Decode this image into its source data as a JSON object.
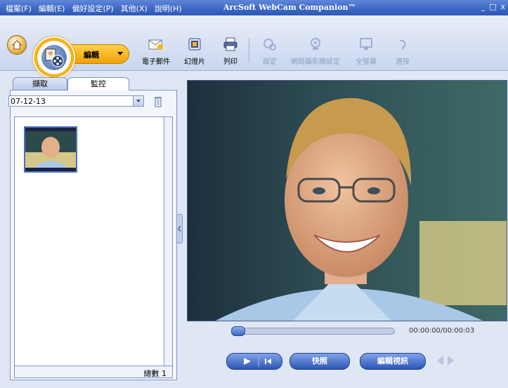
{
  "app": {
    "title": "ArcSoft WebCam Companion™",
    "menu": [
      "檔案(F)",
      "編輯(E)",
      "偏好設定(P)",
      "其他(X)",
      "說明(H)"
    ],
    "window_controls": [
      "_",
      "□",
      "x"
    ]
  },
  "toolbar": {
    "mode_label": "編輯",
    "tools": [
      {
        "label": "電子郵件",
        "icon": "email-icon",
        "enabled": true
      },
      {
        "label": "幻燈片",
        "icon": "slideshow-icon",
        "enabled": true
      },
      {
        "label": "列印",
        "icon": "printer-icon",
        "enabled": true
      },
      {
        "label": "設定",
        "icon": "settings-icon",
        "enabled": false
      },
      {
        "label": "網路攝影機設定",
        "icon": "webcam-settings-icon",
        "enabled": false
      },
      {
        "label": "全螢幕",
        "icon": "fullscreen-icon",
        "enabled": false
      },
      {
        "label": "連接",
        "icon": "connect-icon",
        "enabled": false
      }
    ]
  },
  "left_panel": {
    "tabs": [
      "擷取",
      "監控"
    ],
    "active_tab": "監控",
    "date_value": "07-12-13",
    "item_count_label": "總數 1"
  },
  "player": {
    "time": "00:00:00/00:00:03",
    "progress": 0.0,
    "snapshot_label": "快照",
    "edit_video_label": "編輯視訊"
  },
  "colors": {
    "title_bar": "#3b66c4",
    "accent_orange": "#f5b21a",
    "button_blue": "#2c56b4"
  }
}
